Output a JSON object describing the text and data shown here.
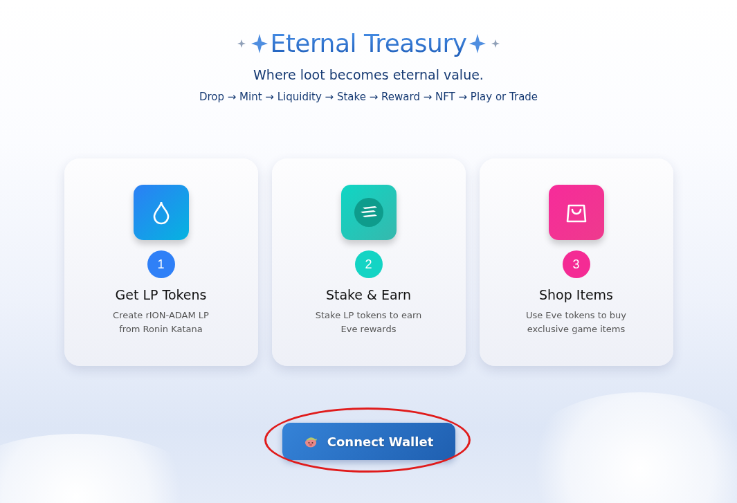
{
  "header": {
    "title": "Eternal Treasury",
    "tagline": "Where loot becomes eternal value.",
    "flow": "Drop → Mint → Liquidity → Stake → Reward → NFT → Play or Trade"
  },
  "steps": [
    {
      "number": "1",
      "title": "Get LP Tokens",
      "description": "Create rION-ADAM LP from Ronin Katana",
      "kind": "drop",
      "color": "#2f80f7"
    },
    {
      "number": "2",
      "title": "Stake & Earn",
      "description": "Stake LP tokens to earn Eve rewards",
      "kind": "stack",
      "color": "#14d4c4"
    },
    {
      "number": "3",
      "title": "Shop Items",
      "description": "Use Eve tokens to buy exclusive game items",
      "kind": "bag",
      "color": "#f42b94"
    }
  ],
  "connect_button": {
    "label": "Connect Wallet"
  }
}
